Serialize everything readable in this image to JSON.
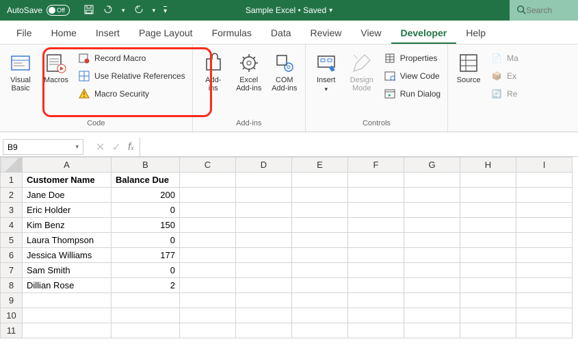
{
  "titlebar": {
    "autosave_label": "AutoSave",
    "autosave_state": "Off",
    "doc_title": "Sample Excel • Saved",
    "search_placeholder": "Search"
  },
  "tabs": {
    "items": [
      "File",
      "Home",
      "Insert",
      "Page Layout",
      "Formulas",
      "Data",
      "Review",
      "View",
      "Developer",
      "Help"
    ],
    "active": "Developer"
  },
  "ribbon": {
    "code": {
      "label": "Code",
      "visual_basic": "Visual\nBasic",
      "macros": "Macros",
      "record_macro": "Record Macro",
      "use_relative": "Use Relative References",
      "macro_security": "Macro Security"
    },
    "addins": {
      "label": "Add-ins",
      "addins": "Add-\nins",
      "excel_addins": "Excel\nAdd-ins",
      "com_addins": "COM\nAdd-ins"
    },
    "controls": {
      "label": "Controls",
      "insert": "Insert",
      "design_mode": "Design\nMode",
      "properties": "Properties",
      "view_code": "View Code",
      "run_dialog": "Run Dialog"
    },
    "xml": {
      "source": "Source",
      "map": "Ma",
      "expand": "Ex",
      "refresh": "Re"
    }
  },
  "formula": {
    "cell_ref": "B9",
    "formula_text": ""
  },
  "sheet": {
    "columns": [
      "A",
      "B",
      "C",
      "D",
      "E",
      "F",
      "G",
      "H",
      "I"
    ],
    "rows": [
      {
        "n": 1,
        "A": "Customer Name",
        "B": "Balance Due",
        "hdr": true
      },
      {
        "n": 2,
        "A": "Jane Doe",
        "B": "200"
      },
      {
        "n": 3,
        "A": "Eric Holder",
        "B": "0"
      },
      {
        "n": 4,
        "A": "Kim Benz",
        "B": "150"
      },
      {
        "n": 5,
        "A": "Laura Thompson",
        "B": "0"
      },
      {
        "n": 6,
        "A": "Jessica Williams",
        "B": "177"
      },
      {
        "n": 7,
        "A": "Sam Smith",
        "B": "0"
      },
      {
        "n": 8,
        "A": "Dillian Rose",
        "B": "2"
      },
      {
        "n": 9,
        "A": "",
        "B": ""
      },
      {
        "n": 10,
        "A": "",
        "B": ""
      },
      {
        "n": 11,
        "A": "",
        "B": ""
      }
    ]
  },
  "annotation": {
    "highlight_target": "code-group-macros-area"
  },
  "chart_data": {
    "type": "table",
    "columns": [
      "Customer Name",
      "Balance Due"
    ],
    "rows": [
      [
        "Jane Doe",
        200
      ],
      [
        "Eric Holder",
        0
      ],
      [
        "Kim Benz",
        150
      ],
      [
        "Laura Thompson",
        0
      ],
      [
        "Jessica Williams",
        177
      ],
      [
        "Sam Smith",
        0
      ],
      [
        "Dillian Rose",
        2
      ]
    ]
  }
}
